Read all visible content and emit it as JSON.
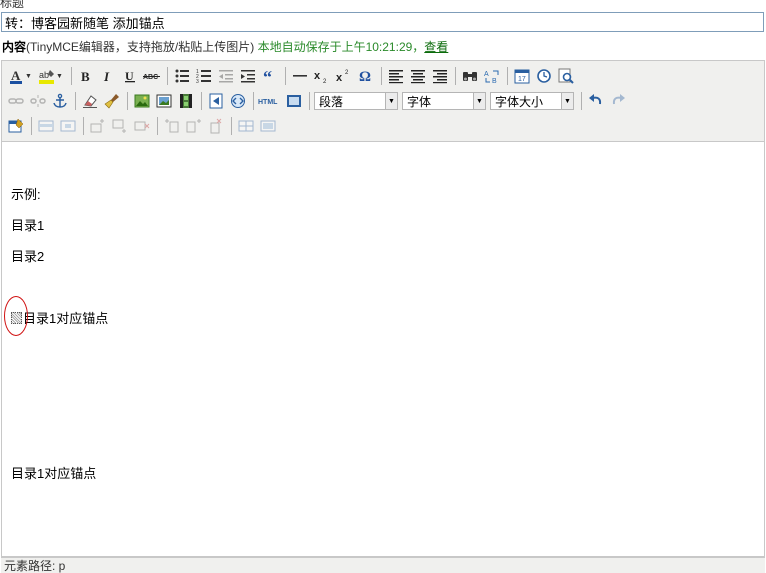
{
  "title_label": "标题",
  "title_value": "转：博客园新随笔 添加锚点",
  "content_label": {
    "bold": "内容",
    "hint": "(TinyMCE编辑器，支持拖放/粘贴上传图片)",
    "saved": "本地自动保存于上午10:21:29，",
    "view_link": "查看"
  },
  "toolbar": {
    "format_select": "段落",
    "font_select": "字体",
    "size_select": "字体大小",
    "html_btn": "HTML",
    "abc": "ABC"
  },
  "content": {
    "p1": "示例:",
    "p2": "目录1",
    "p3": "目录2",
    "p4": "目录1对应锚点",
    "p5": "目录1对应锚点"
  },
  "status_path": "元素路径: p",
  "colors": {
    "saved": "#2a8a2a",
    "circle": "#d01010",
    "toolbar_bg": "#f0f0ee"
  }
}
